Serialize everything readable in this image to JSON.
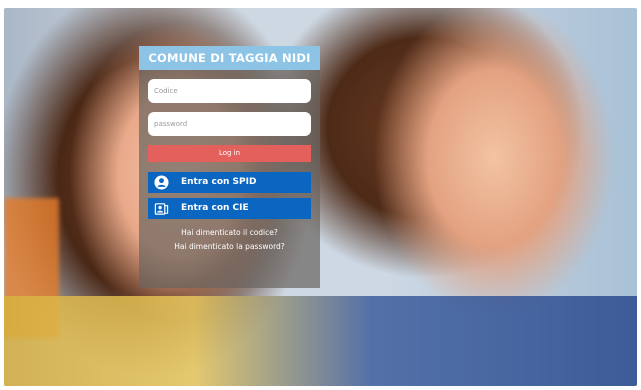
{
  "form": {
    "title": "COMUNE DI TAGGIA NIDI",
    "code_placeholder": "Codice",
    "password_placeholder": "password",
    "login_label": "Log in",
    "spid_label": "Entra con SPID",
    "cie_label": "Entra con CIE",
    "forgot_code": "Hai dimenticato il codice?",
    "forgot_password": "Hai dimenticato la password?"
  },
  "colors": {
    "title_bar": "#8dc3e5",
    "login_button": "#e4605d",
    "id_buttons": "#0b66c2"
  },
  "icons": {
    "spid": "user-circle-icon",
    "cie": "id-card-icon"
  }
}
